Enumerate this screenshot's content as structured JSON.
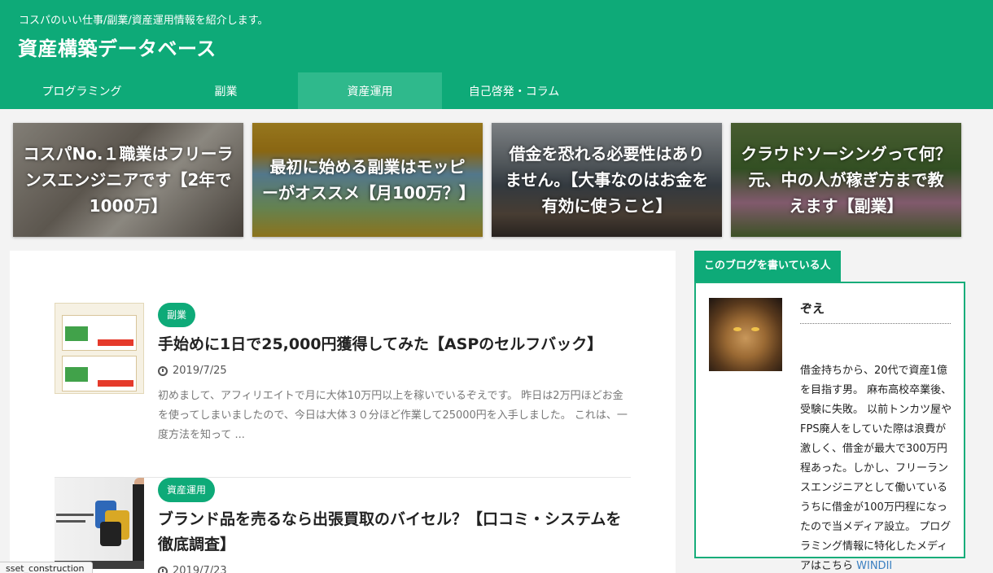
{
  "header": {
    "tagline": "コスパのいい仕事/副業/資産運用情報を紹介します。",
    "site_title": "資産構築データベース"
  },
  "nav": [
    {
      "label": "プログラミング"
    },
    {
      "label": "副業"
    },
    {
      "label": "資産運用",
      "active": true
    },
    {
      "label": "自己啓発・コラム"
    }
  ],
  "featured": [
    {
      "title": "コスパNo.１職業はフリーランスエンジニアです【2年で1000万】"
    },
    {
      "title": "最初に始める副業はモッピーがオススメ【月100万？】"
    },
    {
      "title": "借金を恐れる必要性はありません。【大事なのはお金を有効に使うこと】"
    },
    {
      "title": "クラウドソーシングって何？元、中の人が稼ぎ方まで教えます【副業】"
    }
  ],
  "posts": [
    {
      "category": "副業",
      "title": "手始めに1日で25,000円獲得してみた【ASPのセルフバック】",
      "date": "2019/7/25",
      "excerpt": "初めまして、アフィリエイトで月に大体10万円以上を稼いでいるぞえです。 昨日は2万円ほどお金を使ってしまいましたので、今日は大体３０分ほど作業して25000円を入手しました。 これは、一度方法を知って ..."
    },
    {
      "category": "資産運用",
      "title": "ブランド品を売るなら出張買取のバイセル？【口コミ・システムを徹底調査】",
      "date": "2019/7/23"
    }
  ],
  "sidebar": {
    "widget_title": "このブログを書いている人",
    "author_name": "ぞえ",
    "author_bio": "借金持ちから、20代で資産1億を目指す男。 麻布高校卒業後、受験に失敗。 以前トンカツ屋やFPS廃人をしていた際は浪費が激しく、借金が最大で300万円程あった。しかし、フリーランスエンジニアとして働いているうちに借金が100万円程になったので当メディア設立。 プログラミング情報に特化したメディアはこちら ",
    "author_link": "WINDII"
  },
  "statusbar": {
    "text": "sset_construction"
  },
  "colors": {
    "brand": "#0eaa78",
    "link": "#3a7fc1"
  },
  "icons": {
    "date": "clock-icon"
  }
}
